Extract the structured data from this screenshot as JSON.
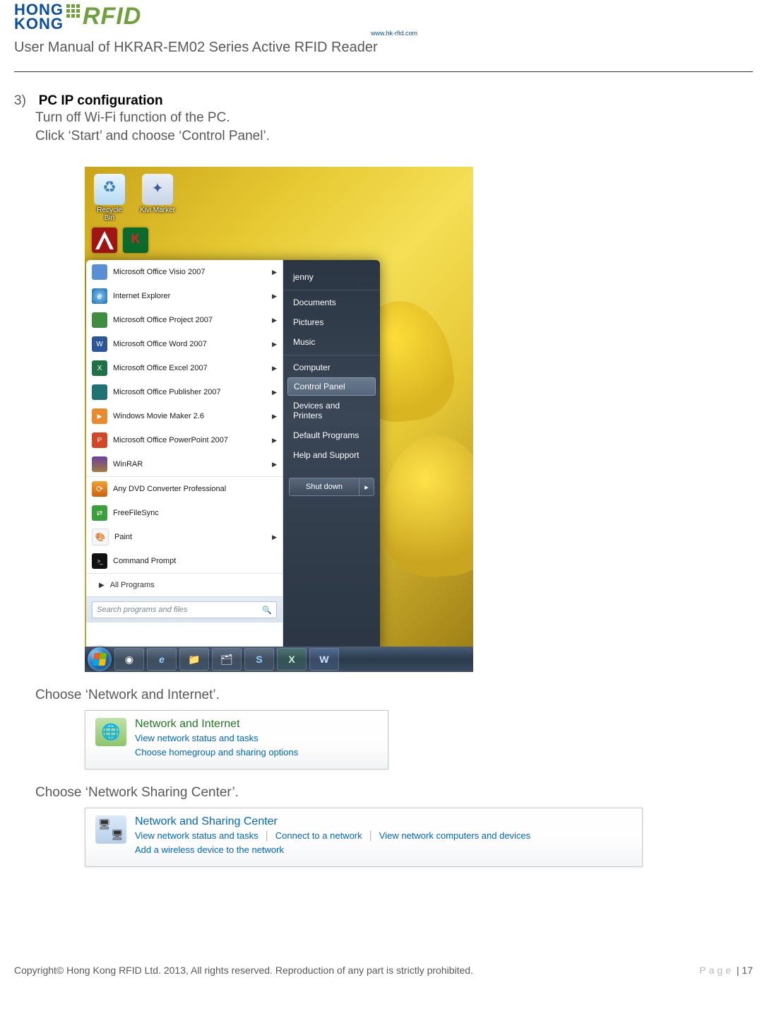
{
  "header": {
    "logo_top": "HONG",
    "logo_bottom": "KONG",
    "logo_rfid": "RFID",
    "logo_url": "www.hk-rfid.com",
    "doc_title": "User Manual of HKRAR-EM02 Series Active RFID Reader"
  },
  "section": {
    "number": "3)",
    "title": "PC IP configuration",
    "line1": "Turn off Wi-Fi function of the PC.",
    "line2": "Click ‘Start’ and choose ‘Control Panel’."
  },
  "desktop": {
    "recycle": "Recycle Bin",
    "kivi": "Kivi Marker"
  },
  "start_left": [
    {
      "label": "Microsoft Office Visio 2007",
      "icon": "i-visio",
      "arrow": true,
      "sep": false
    },
    {
      "label": "Internet Explorer",
      "icon": "i-ie",
      "arrow": true,
      "sep": false
    },
    {
      "label": "Microsoft Office Project 2007",
      "icon": "i-proj",
      "arrow": true,
      "sep": false
    },
    {
      "label": "Microsoft Office Word 2007",
      "icon": "i-word",
      "arrow": true,
      "sep": false
    },
    {
      "label": "Microsoft Office Excel 2007",
      "icon": "i-excel",
      "arrow": true,
      "sep": false
    },
    {
      "label": "Microsoft Office Publisher 2007",
      "icon": "i-pub",
      "arrow": true,
      "sep": false
    },
    {
      "label": "Windows Movie Maker 2.6",
      "icon": "i-mm",
      "arrow": true,
      "sep": false
    },
    {
      "label": "Microsoft Office PowerPoint 2007",
      "icon": "i-ppt",
      "arrow": true,
      "sep": false
    },
    {
      "label": "WinRAR",
      "icon": "i-rar",
      "arrow": true,
      "sep": false
    },
    {
      "label": "Any DVD Converter Professional",
      "icon": "i-dvd",
      "arrow": false,
      "sep": true
    },
    {
      "label": "FreeFileSync",
      "icon": "i-ffs",
      "arrow": false,
      "sep": false
    },
    {
      "label": "Paint",
      "icon": "i-paint",
      "arrow": true,
      "sep": false
    },
    {
      "label": "Command Prompt",
      "icon": "i-cmd",
      "arrow": false,
      "sep": false
    }
  ],
  "start_all": "All Programs",
  "start_search_placeholder": "Search programs and files",
  "start_right": {
    "user": "jenny",
    "items": [
      "Documents",
      "Pictures",
      "Music",
      "Computer"
    ],
    "selected": "Control Panel",
    "items2": [
      "Devices and Printers",
      "Default Programs",
      "Help and Support"
    ],
    "shutdown": "Shut down"
  },
  "step2": "Choose ‘Network and Internet’.",
  "cp1": {
    "title": "Network and Internet",
    "sub1": "View network status and tasks",
    "sub2": "Choose homegroup and sharing options"
  },
  "step3": "Choose ‘Network Sharing Center’.",
  "cp2": {
    "title": "Network and Sharing Center",
    "links": [
      "View network status and tasks",
      "Connect to a network",
      "View network computers and devices"
    ],
    "sub": "Add a wireless device to the network"
  },
  "footer": {
    "copyright": "Copyright© Hong Kong RFID Ltd. 2013, All rights reserved. Reproduction of any part is strictly prohibited.",
    "page_label": "Page",
    "page_sep": " | ",
    "page_num": "17"
  }
}
